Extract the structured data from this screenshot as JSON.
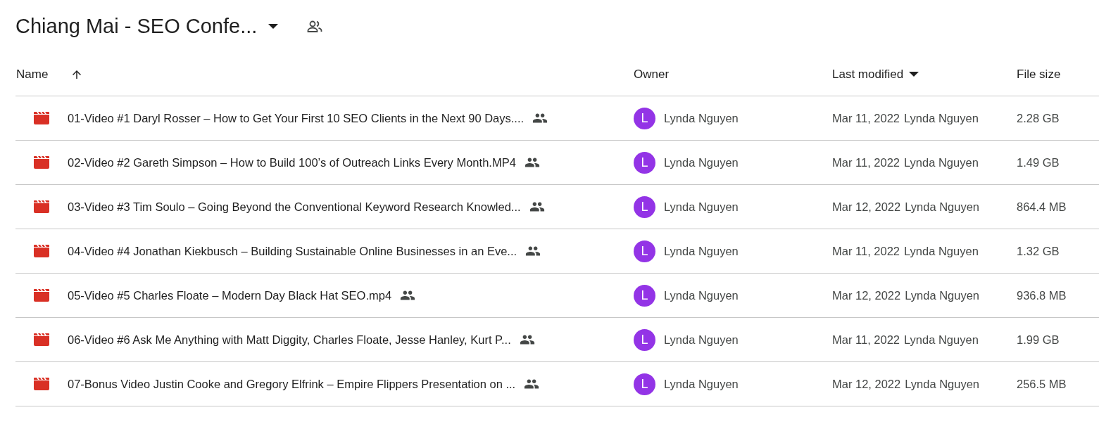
{
  "folder": {
    "title": "Chiang Mai - SEO Confe...",
    "shared": true
  },
  "table": {
    "columns": [
      {
        "label": "Name",
        "kind": "ascending"
      },
      {
        "label": "Owner",
        "kind": "plain"
      },
      {
        "label": "Last modified",
        "kind": "descending"
      },
      {
        "label": "File size",
        "kind": "plain"
      }
    ],
    "rows": [
      {
        "name": "01-Video #1 Daryl Rosser – How to Get Your First 10 SEO Clients in the Next 90 Days....",
        "shared": true,
        "avatar_letter": "L",
        "owner": "Lynda Nguyen",
        "modified": "Mar 11, 2022",
        "modified_by": "Lynda Nguyen",
        "size": "2.28 GB"
      },
      {
        "name": "02-Video #2 Gareth Simpson – How to Build 100’s of Outreach Links Every Month.MP4",
        "shared": true,
        "avatar_letter": "L",
        "owner": "Lynda Nguyen",
        "modified": "Mar 11, 2022",
        "modified_by": "Lynda Nguyen",
        "size": "1.49 GB"
      },
      {
        "name": "03-Video #3 Tim Soulo – Going Beyond the Conventional Keyword Research Knowled...",
        "shared": true,
        "avatar_letter": "L",
        "owner": "Lynda Nguyen",
        "modified": "Mar 12, 2022",
        "modified_by": "Lynda Nguyen",
        "size": "864.4 MB"
      },
      {
        "name": "04-Video #4 Jonathan Kiekbusch – Building Sustainable Online Businesses in an Eve...",
        "shared": true,
        "avatar_letter": "L",
        "owner": "Lynda Nguyen",
        "modified": "Mar 11, 2022",
        "modified_by": "Lynda Nguyen",
        "size": "1.32 GB"
      },
      {
        "name": "05-Video #5 Charles Floate – Modern Day Black Hat SEO.mp4",
        "shared": true,
        "avatar_letter": "L",
        "owner": "Lynda Nguyen",
        "modified": "Mar 12, 2022",
        "modified_by": "Lynda Nguyen",
        "size": "936.8 MB"
      },
      {
        "name": "06-Video #6 Ask Me Anything with Matt Diggity, Charles Floate, Jesse Hanley, Kurt P...",
        "shared": true,
        "avatar_letter": "L",
        "owner": "Lynda Nguyen",
        "modified": "Mar 11, 2022",
        "modified_by": "Lynda Nguyen",
        "size": "1.99 GB"
      },
      {
        "name": "07-Bonus Video Justin Cooke and Gregory Elfrink – Empire Flippers Presentation on ...",
        "shared": true,
        "avatar_letter": "L",
        "owner": "Lynda Nguyen",
        "modified": "Mar 12, 2022",
        "modified_by": "Lynda Nguyen",
        "size": "256.5 MB"
      }
    ]
  }
}
